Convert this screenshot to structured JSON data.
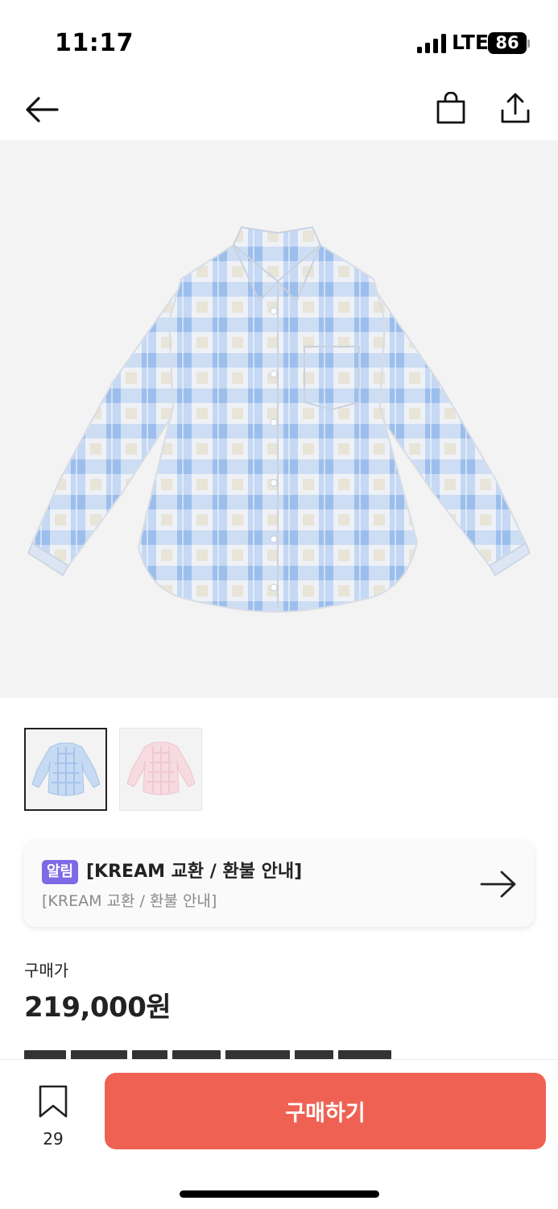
{
  "status_bar": {
    "time": "11:17",
    "network": "LTE",
    "battery": "86"
  },
  "nav": {
    "back_icon": "arrow-left-icon",
    "bag_icon": "shopping-bag-icon",
    "share_icon": "share-icon"
  },
  "product": {
    "image": "plaid-shirt-blue",
    "thumbnails": [
      {
        "name": "thumbnail-blue",
        "color": "#a9c8ef",
        "selected": true
      },
      {
        "name": "thumbnail-pink",
        "color": "#f1c3cc",
        "selected": false
      }
    ]
  },
  "notice": {
    "badge": "알림",
    "title": "[KREAM 교환 / 환불 안내]",
    "subtitle": "[KREAM 교환 / 환불 안내]"
  },
  "price": {
    "label": "구매가",
    "value": "219,000원"
  },
  "bottom_bar": {
    "bookmark_count": "29",
    "buy_label": "구매하기"
  },
  "colors": {
    "accent": "#ef6253",
    "badge": "#7c6ae6"
  }
}
